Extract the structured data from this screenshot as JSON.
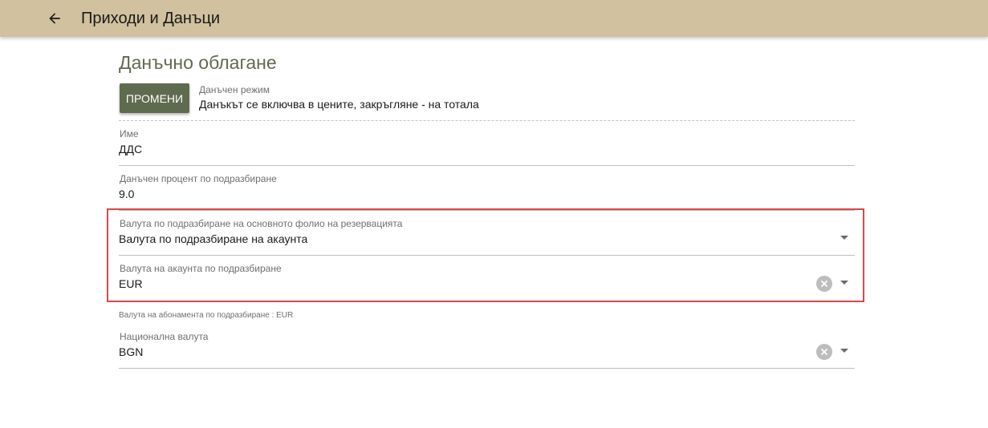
{
  "header": {
    "back_icon": "arrow-left-icon",
    "title": "Приходи и Данъци"
  },
  "section": {
    "title": "Данъчно облагане"
  },
  "tax_mode": {
    "change_button_label": "ПРОМЕНИ",
    "label": "Данъчен режим",
    "value": "Данъкът се включва в цените,  закръгляне - на тотала"
  },
  "fields": {
    "name": {
      "label": "Име",
      "value": "ДДС"
    },
    "default_tax_rate": {
      "label": "Данъчен процент по подразбиране",
      "value": "9.0"
    },
    "folio_currency": {
      "label": "Валута по подразбиране на основното фолио на резервацията",
      "value": "Валута по подразбиране на акаунта"
    },
    "account_currency": {
      "label": "Валута на акаунта по подразбиране",
      "value": "EUR"
    },
    "subscription_note": "Валута на абонамента по подразбиране : EUR",
    "national_currency": {
      "label": "Национална валута",
      "value": "BGN"
    }
  },
  "colors": {
    "topbar": "#d1c19e",
    "accent": "#5f6b4f",
    "highlight": "#e2444b"
  }
}
